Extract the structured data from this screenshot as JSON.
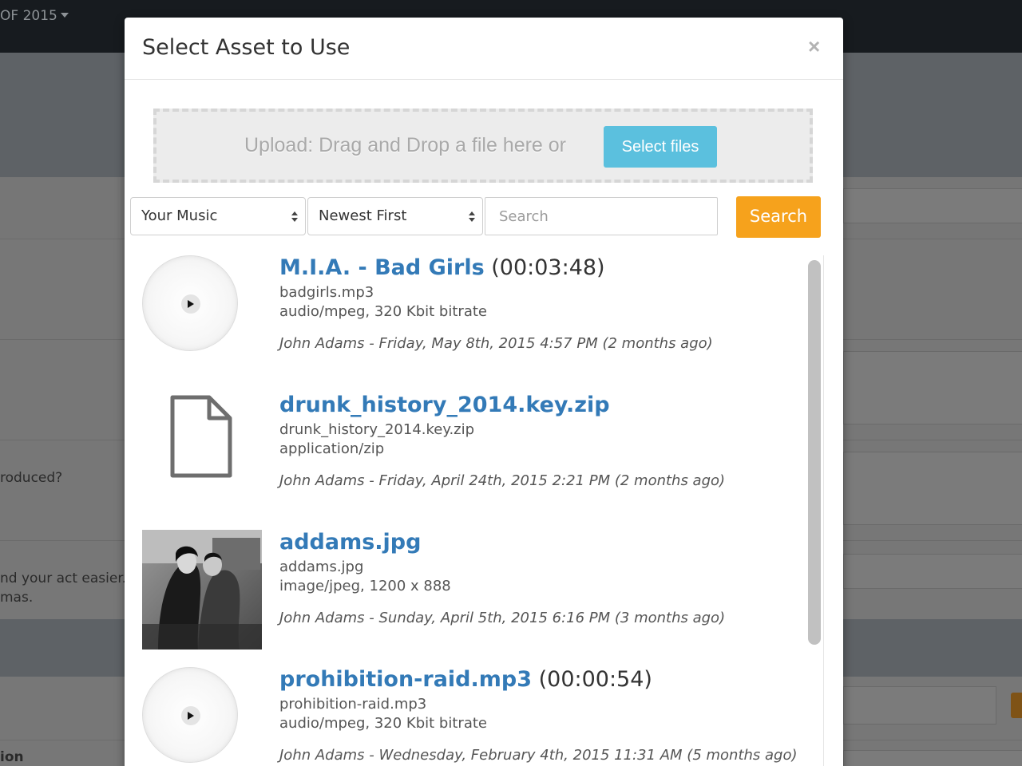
{
  "background": {
    "year_menu": "OF 2015",
    "text_produced": "roduced?",
    "text_act_line1": "nd your act easier.",
    "text_act_line2": "mas.",
    "text_bottom": "ion"
  },
  "modal": {
    "title": "Select Asset to Use",
    "close_label": "×"
  },
  "upload": {
    "prompt": "Upload: Drag and Drop a file here or",
    "select_button": "Select files"
  },
  "filters": {
    "source_selected": "Your Music",
    "sort_selected": "Newest First",
    "search_placeholder": "Search",
    "search_value": "",
    "search_button": "Search"
  },
  "assets": [
    {
      "thumb": "audio-disc-icon",
      "name": "M.I.A. - Bad Girls",
      "duration": "(00:03:48)",
      "line1": "badgirls.mp3",
      "line2": "audio/mpeg, 320 Kbit bitrate",
      "meta": "John Adams - Friday, May 8th, 2015 4:57 PM (2 months ago)"
    },
    {
      "thumb": "file-icon",
      "name": "drunk_history_2014.key.zip",
      "duration": "",
      "line1": "drunk_history_2014.key.zip",
      "line2": "application/zip",
      "meta": "John Adams - Friday, April 24th, 2015 2:21 PM (2 months ago)"
    },
    {
      "thumb": "image-thumbnail",
      "name": "addams.jpg",
      "duration": "",
      "line1": "addams.jpg",
      "line2": "image/jpeg, 1200 x 888",
      "meta": "John Adams - Sunday, April 5th, 2015 6:16 PM (3 months ago)"
    },
    {
      "thumb": "audio-disc-icon",
      "name": "prohibition-raid.mp3",
      "duration": "(00:00:54)",
      "line1": "prohibition-raid.mp3",
      "line2": "audio/mpeg, 320 Kbit bitrate",
      "meta": "John Adams - Wednesday, February 4th, 2015 11:31 AM (5 months ago)"
    }
  ],
  "colors": {
    "link": "#337ab7",
    "info_button": "#5bc0de",
    "search_button": "#f6a21c"
  }
}
